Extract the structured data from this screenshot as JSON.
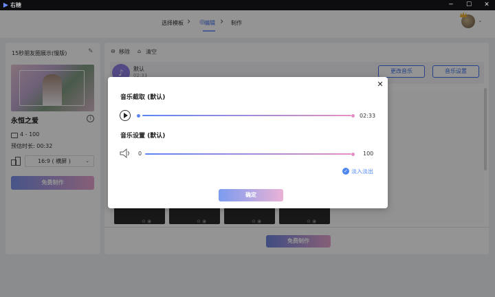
{
  "app": {
    "title": "右糖"
  },
  "window_controls": {
    "minimize": "─",
    "maximize": "☐",
    "close": "✕"
  },
  "steps": [
    {
      "label": "选择模板"
    },
    {
      "label": "编辑",
      "active": true
    },
    {
      "label": "制作"
    }
  ],
  "left_panel": {
    "template_title": "15秒朋友圈展示(慢版)",
    "template_name": "永恒之爱",
    "info_glyph": "i",
    "photo_count": "4 - 100",
    "duration": "预估时长: 00:32",
    "aspect_ratio": "16:9 ( 横屏 )",
    "make_button": "免费制作"
  },
  "right_panel": {
    "remove_label": "移除",
    "clear_label": "清空",
    "music_name": "默认",
    "music_time": "02:33",
    "change_music_button": "更改音乐",
    "music_settings_button": "音乐设置",
    "make_button": "免费制作"
  },
  "modal": {
    "close_glyph": "✕",
    "music_clip_title": "音乐截取 (默认)",
    "clip_end_time": "02:33",
    "music_settings_title": "音乐设置 (默认)",
    "volume_min": "0",
    "volume_max": "100",
    "volume_level": 1.0,
    "fade_label": "淡入淡出",
    "fade_checked": true,
    "confirm_button": "确定"
  },
  "colors": {
    "accent_blue": "#3f6ee8",
    "gradient_start": "#5b86f0",
    "gradient_end": "#e48fc3"
  },
  "icons": [
    "play-icon",
    "volume-icon",
    "check-icon",
    "close-icon",
    "edit-icon",
    "info-icon",
    "image-icon",
    "aspect-ratio-icon",
    "remove-icon",
    "clear-icon",
    "music-icon",
    "crown-icon"
  ]
}
